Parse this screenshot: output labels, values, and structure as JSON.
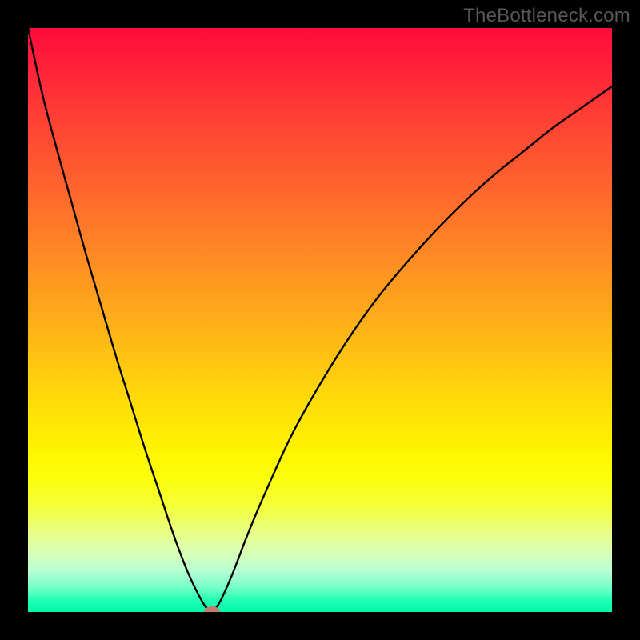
{
  "watermark": "TheBottleneck.com",
  "chart_data": {
    "type": "line",
    "title": "",
    "xlabel": "",
    "ylabel": "",
    "xlim": [
      0,
      100
    ],
    "ylim": [
      0,
      100
    ],
    "grid": false,
    "legend": false,
    "gradient_stops": [
      {
        "pos": 0,
        "color": "#ff0a3c"
      },
      {
        "pos": 50,
        "color": "#ffc400"
      },
      {
        "pos": 80,
        "color": "#fff300"
      },
      {
        "pos": 100,
        "color": "#00f7a6"
      }
    ],
    "series": [
      {
        "name": "bottleneck-curve",
        "x": [
          0,
          2.5,
          5,
          7.5,
          10,
          12.5,
          15,
          17.5,
          20,
          22.5,
          25,
          27.5,
          30,
          31,
          31.5,
          32,
          33,
          35,
          37.5,
          40,
          45,
          50,
          55,
          60,
          65,
          70,
          75,
          80,
          85,
          90,
          95,
          100
        ],
        "values": [
          100,
          88.5,
          79,
          70,
          61,
          52.5,
          44,
          36,
          28,
          20.5,
          13,
          6.5,
          1.5,
          0.5,
          0,
          0.5,
          2,
          6.5,
          13,
          19,
          30,
          39,
          47,
          54,
          60,
          65.5,
          70.5,
          75,
          79,
          83,
          86.5,
          90
        ]
      }
    ],
    "marker": {
      "x": 31.5,
      "y": 0,
      "color": "#c77b6e"
    }
  }
}
